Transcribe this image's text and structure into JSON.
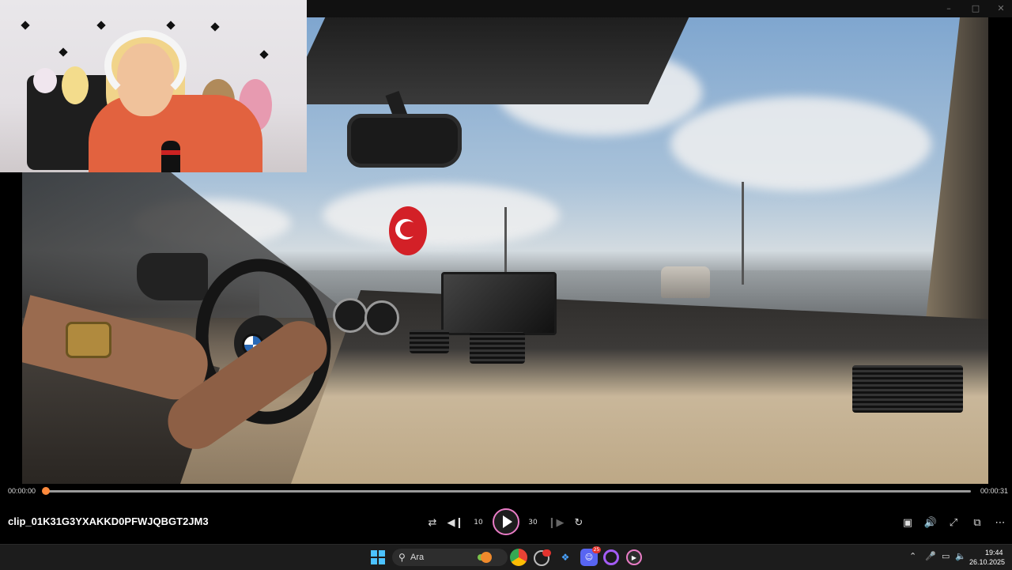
{
  "player": {
    "time_current": "00:00:00",
    "time_total": "00:00:31",
    "progress_fraction": 0,
    "clip_title": "clip_01K31G3YXAKKD0PFWJQBGT2JM3",
    "accent_color": "#e97cc6",
    "progress_color": "#ff8a3c",
    "controls": {
      "shuffle_icon": "shuffle-icon",
      "previous_icon": "previous-icon",
      "rewind_icon": "rewind-10-icon",
      "play_icon": "play-icon",
      "forward_icon": "forward-30-icon",
      "next_icon": "next-icon",
      "repeat_icon": "repeat-off-icon",
      "rewind_label": "10",
      "forward_label": "30"
    },
    "right_controls": [
      "miniplayer-icon",
      "volume-icon",
      "fullscreen-icon",
      "cast-icon",
      "more-icon"
    ]
  },
  "taskbar": {
    "search_placeholder": "Ara",
    "apps": [
      "chrome-icon",
      "app-red-dot-icon",
      "app-blue-icon",
      "discord-icon",
      "app-purple-icon",
      "media-player-icon"
    ],
    "discord_badge": "25",
    "clock_time": "19:44",
    "clock_date": "26.10.2025"
  }
}
